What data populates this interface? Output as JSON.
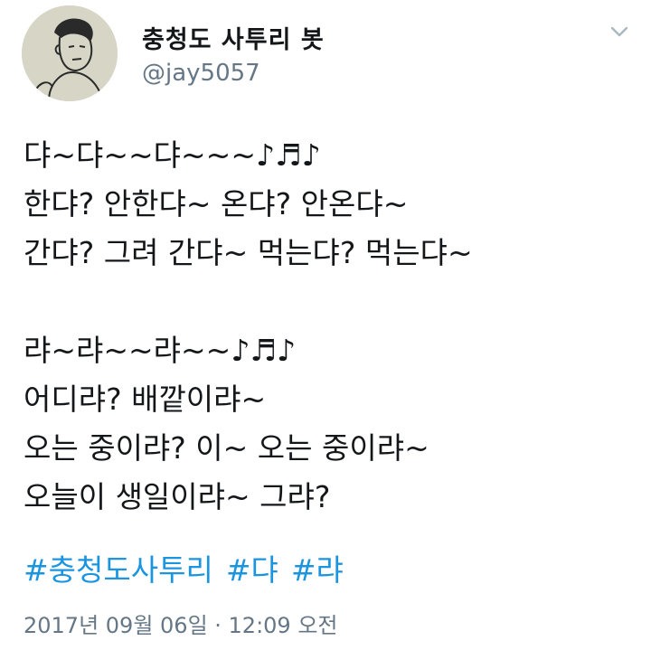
{
  "author": {
    "display_name": "충청도 사투리 봇",
    "handle": "@jay5057",
    "avatar_icon": "cartoon-man-avatar"
  },
  "menu": {
    "icon": "chevron-down-icon"
  },
  "tweet": {
    "lines": [
      "댜~댜~~댜~~~♪♬♪",
      "한댜? 안한댜~ 온댜? 안온댜~",
      "간댜? 그려 간댜~ 먹는댜? 먹는댜~",
      "",
      "랴~랴~~랴~~♪♬♪",
      "어디랴? 배깥이랴~",
      "오는 중이랴? 이~ 오는 중이랴~",
      "오늘이 생일이랴~ 그랴?"
    ],
    "hashtags": [
      "#충청도사투리",
      "#댜",
      "#랴"
    ],
    "timestamp": "2017년 09월 06일 · 12:09 오전"
  },
  "colors": {
    "text": "#14171a",
    "secondary": "#657786",
    "link": "#1b95e0"
  }
}
